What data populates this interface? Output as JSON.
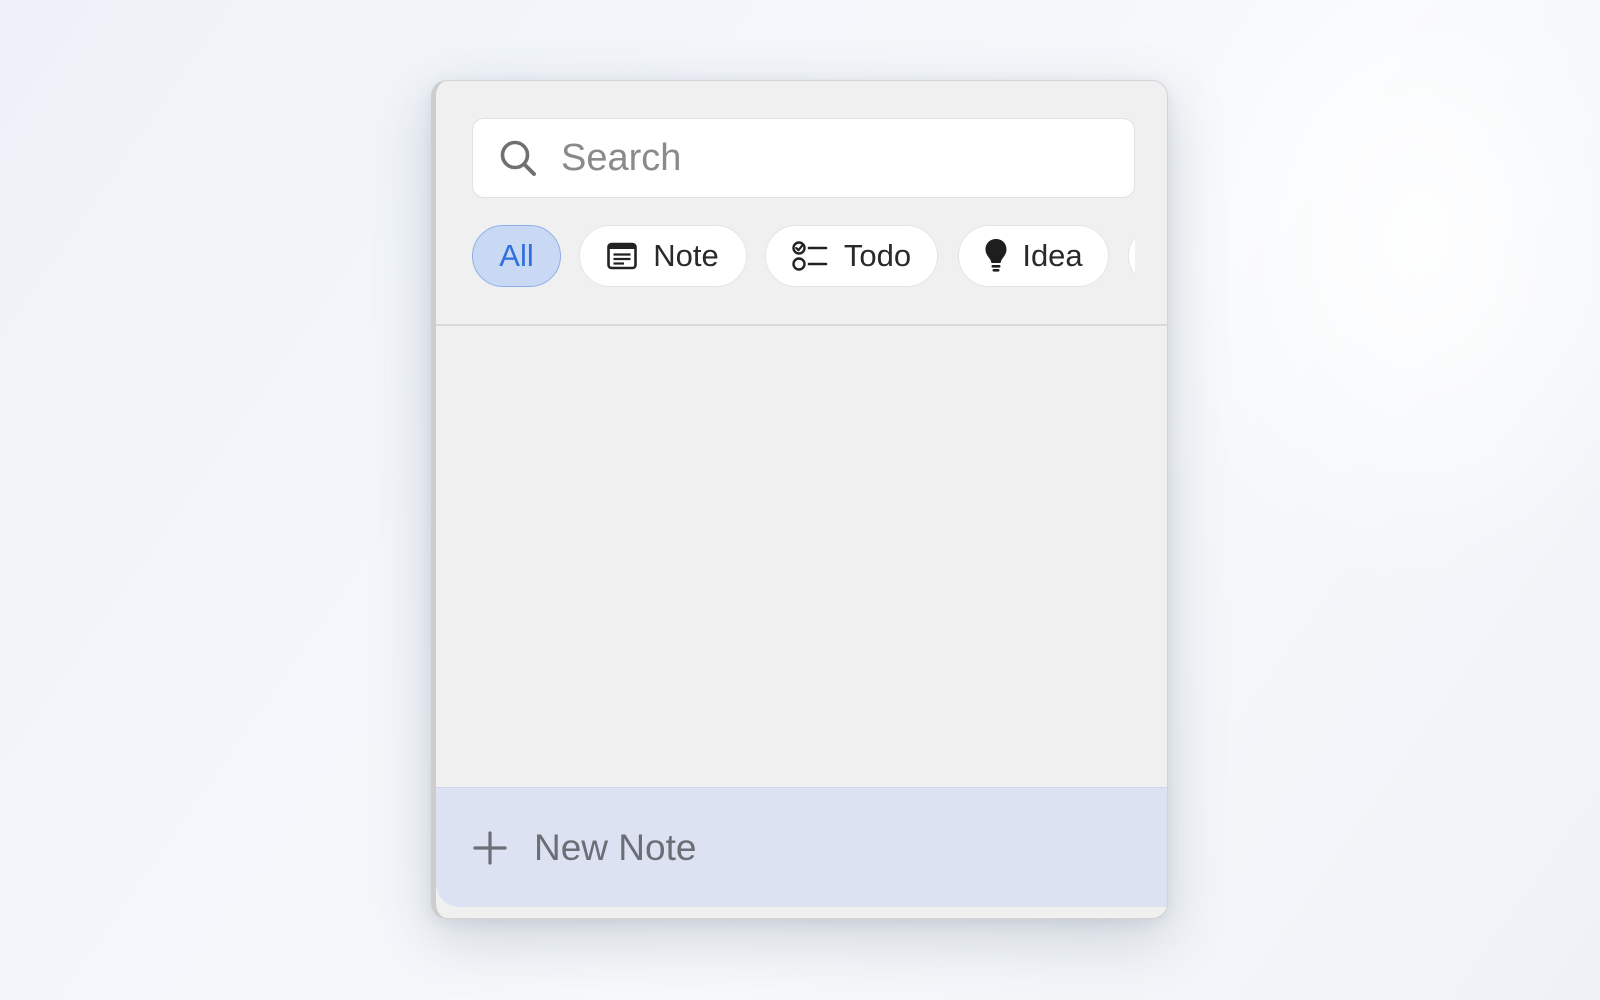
{
  "search": {
    "placeholder": "Search",
    "icon": "magnifier"
  },
  "filters": [
    {
      "label": "All",
      "active": true,
      "icon": ""
    },
    {
      "label": "Note",
      "active": false,
      "icon": "note-document"
    },
    {
      "label": "Todo",
      "active": false,
      "icon": "checklist"
    },
    {
      "label": "Idea",
      "active": false,
      "icon": "lightbulb"
    }
  ],
  "footer": {
    "new_note_label": "New Note",
    "icon": "plus"
  },
  "colors": {
    "panel_bg": "#f0f0f0",
    "active_chip_bg": "#c9d8f3",
    "active_chip_text": "#2f6fde",
    "footer_bg": "#dce2f1"
  }
}
